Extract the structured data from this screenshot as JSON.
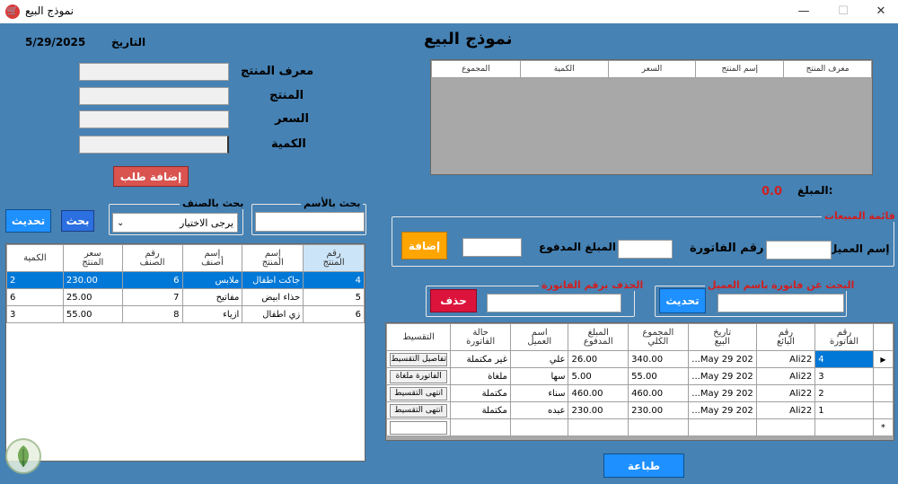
{
  "window": {
    "title": "نموذج البيع",
    "minimize": "—",
    "maximize": "☐",
    "close": "✕"
  },
  "header": {
    "form_title": "نموذج البيع",
    "date_label": "التاريخ",
    "date_value": "5/29/2025"
  },
  "product_form": {
    "id_label": "معرف المنتج",
    "product_label": "المنتج",
    "price_label": "السعر",
    "qty_label": "الكمية",
    "add_order_button": "إضافة طلب"
  },
  "search": {
    "by_name_title": "بحث بالأسم",
    "by_category_title": "بحث بالصنف",
    "category_selected": "يرجى الاختيار",
    "search_button": "بحث",
    "refresh_button": "تحديث"
  },
  "products_table": {
    "columns": [
      "رقم\nالمنتج",
      "إسم\nالمنتج",
      "إسم\nأصنف",
      "رقم\nالصنف",
      "سعر\nالمنتج",
      "الكمية"
    ],
    "rows": [
      [
        "4",
        "جاكت اطفال",
        "ملابس",
        "6",
        "230.00",
        "2"
      ],
      [
        "5",
        "حذاء ابيض",
        "مفاتيح",
        "7",
        "25.00",
        "6"
      ],
      [
        "6",
        "زي اطفال",
        "ازياء",
        "8",
        "55.00",
        "3"
      ]
    ]
  },
  "order_table": {
    "columns": [
      "معرف المنتج",
      "إسم المنتج",
      "السعر",
      "الكمية",
      "المجموع"
    ]
  },
  "amount": {
    "label": "المبلغ:",
    "value": "0.0"
  },
  "sales_list": {
    "title": "قائمة المبيعات",
    "customer_label": "إسم العميل",
    "invoice_label": "رقم الفاتورة",
    "paid_label": "المبلغ المدفوع",
    "add_button": "إضافة"
  },
  "search_customer": {
    "title": "البحث عن فاتورة باسم العميل",
    "refresh_button": "تحديث"
  },
  "delete_invoice": {
    "title": "الحذف برقم الفاتورة",
    "delete_button": "حذف"
  },
  "invoices_table": {
    "columns": [
      "رقم\nالفاتورة",
      "رقم\nالبائع",
      "تاريخ\nالبيع",
      "المجموع\nالكلي",
      "المبلغ\nالمدفوع",
      "اسم\nالعميل",
      "حالة\nالفاتورة",
      "التقسيط"
    ],
    "rows": [
      [
        "4",
        "Ali22",
        "May 29 202...",
        "340.00",
        "26.00",
        "علي",
        "غير مكتملة",
        "تفاصيل التقسيط"
      ],
      [
        "3",
        "Ali22",
        "May 29 202...",
        "55.00",
        "5.00",
        "سها",
        "ملغاة",
        "الفاتورة ملغاة"
      ],
      [
        "2",
        "Ali22",
        "May 29 202...",
        "460.00",
        "460.00",
        "سناء",
        "مكتملة",
        "انتهى التقسيط"
      ],
      [
        "1",
        "Ali22",
        "May 29 202...",
        "230.00",
        "230.00",
        "عبده",
        "مكتملة",
        "انتهى التقسيط"
      ]
    ],
    "new_row_marker": "*",
    "current_row_marker": "▶"
  },
  "print_button": "طباعة",
  "colors": {
    "background": "#4682b4",
    "add_order": "#d9534f",
    "add": "#ffa500",
    "delete": "#dc143c",
    "blue_button": "#1e90ff",
    "amount_value": "#d21e1e",
    "group_title": "#d21e1e",
    "selected_row": "#0078d7"
  }
}
